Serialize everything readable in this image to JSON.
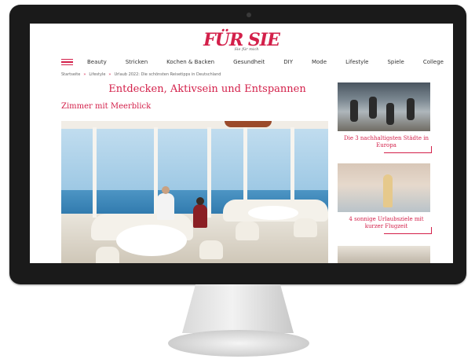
{
  "site": {
    "brand": "FÜR SIE",
    "tagline": "Sie für mich"
  },
  "nav": {
    "menu_icon": "hamburger-menu-icon",
    "items": [
      "Beauty",
      "Stricken",
      "Kochen & Backen",
      "Gesundheit",
      "DIY",
      "Mode",
      "Lifestyle",
      "Spiele",
      "College"
    ]
  },
  "breadcrumb": [
    "Startseite",
    "Lifestyle",
    "Urlaub 2022: Die schönsten Reisetipps in Deutschland"
  ],
  "article": {
    "headline": "Entdecken, Aktivsein und Entspannen",
    "subheadline": "Zimmer mit Meerblick"
  },
  "sidebar": {
    "teasers": [
      {
        "title": "Die 3 nachhaltigsten Städte in Europa"
      },
      {
        "title": "4 sonnige Urlaubsziele mit kurzer Flugzeit"
      },
      {
        "title": ""
      }
    ]
  },
  "colors": {
    "accent": "#d3204a",
    "bezel": "#1a1a1a"
  }
}
